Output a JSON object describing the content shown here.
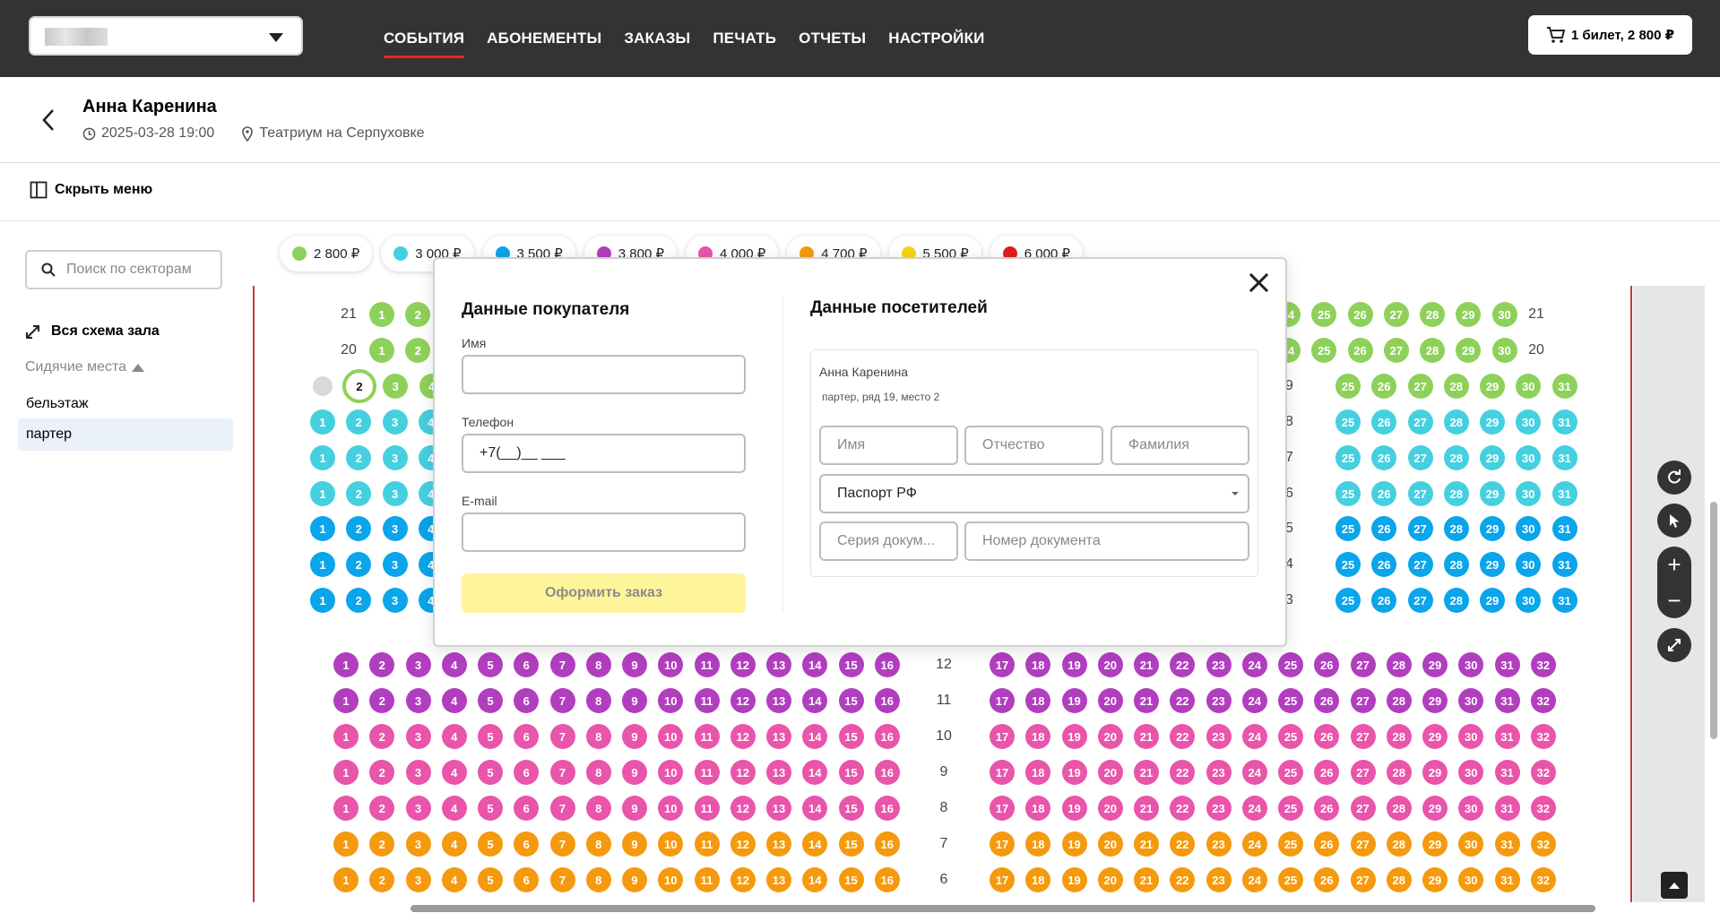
{
  "topbar": {
    "venue_select_value": "",
    "nav": [
      "СОБЫТИЯ",
      "АБОНЕМЕНТЫ",
      "ЗАКАЗЫ",
      "ПЕЧАТЬ",
      "ОТЧЕТЫ",
      "НАСТРОЙКИ"
    ],
    "active_nav": "СОБЫТИЯ",
    "cart_label": "1 билет, 2 800 ₽"
  },
  "event": {
    "title": "Анна Каренина",
    "datetime": "2025-03-28 19:00",
    "venue": "Театриум на Серпуховке"
  },
  "menu_toggle_label": "Скрыть меню",
  "sidebar": {
    "search_placeholder": "Поиск по секторам",
    "scheme_link": "Вся схема зала",
    "group_label": "Сидячие места",
    "sectors": [
      "бельэтаж",
      "партер"
    ],
    "active_sector": "партер"
  },
  "prices": [
    {
      "label": "2 800 ₽",
      "color": "#8ed15a"
    },
    {
      "label": "3 000 ₽",
      "color": "#45d0e0"
    },
    {
      "label": "3 500 ₽",
      "color": "#0aa5ea"
    },
    {
      "label": "3 800 ₽",
      "color": "#b13ebf"
    },
    {
      "label": "4 000 ₽",
      "color": "#e855aa"
    },
    {
      "label": "4 700 ₽",
      "color": "#f59a0e"
    },
    {
      "label": "5 500 ₽",
      "color": "#f8d512"
    },
    {
      "label": "6 000 ₽",
      "color": "#e21d1d"
    }
  ],
  "selected_seat": {
    "row": "19",
    "seat": "2"
  },
  "hall": {
    "top_rows": [
      {
        "row": "21",
        "color": "#8ed15a",
        "left": [
          1,
          2
        ],
        "right": [
          24,
          25,
          26,
          27,
          28,
          29,
          30
        ],
        "label_right": "21"
      },
      {
        "row": "20",
        "color": "#8ed15a",
        "left": [
          1,
          2
        ],
        "right": [
          24,
          25,
          26,
          27,
          28,
          29,
          30
        ],
        "label_right": "20"
      },
      {
        "row": "19",
        "color": "#8ed15a",
        "left": [
          2,
          3,
          4
        ],
        "right": [
          25,
          26,
          27,
          28,
          29,
          30,
          31
        ],
        "label_right": "19"
      },
      {
        "row": "18",
        "color": "#45d0e0",
        "left": [
          1,
          2,
          3,
          4
        ],
        "right": [
          25,
          26,
          27,
          28,
          29,
          30,
          31
        ],
        "label_right": "18"
      },
      {
        "row": "17",
        "color": "#45d0e0",
        "left": [
          1,
          2,
          3,
          4
        ],
        "right": [
          25,
          26,
          27,
          28,
          29,
          30,
          31
        ],
        "label_right": "17"
      },
      {
        "row": "16",
        "color": "#45d0e0",
        "left": [
          1,
          2,
          3,
          4
        ],
        "right": [
          25,
          26,
          27,
          28,
          29,
          30,
          31
        ],
        "label_right": "16"
      },
      {
        "row": "15",
        "color": "#0aa5ea",
        "left": [
          1,
          2,
          3,
          4
        ],
        "right": [
          25,
          26,
          27,
          28,
          29,
          30,
          31
        ],
        "label_right": "15"
      },
      {
        "row": "14",
        "color": "#0aa5ea",
        "left": [
          1,
          2,
          3,
          4
        ],
        "right": [
          25,
          26,
          27,
          28,
          29,
          30,
          31
        ],
        "label_right": "14"
      },
      {
        "row": "13",
        "color": "#0aa5ea",
        "left": [
          1,
          2,
          3,
          4
        ],
        "right": [
          25,
          26,
          27,
          28,
          29,
          30,
          31
        ],
        "label_right": "13"
      }
    ],
    "bottom_rows": [
      {
        "row": "12",
        "color": "#b13ebf"
      },
      {
        "row": "11",
        "color": "#b13ebf"
      },
      {
        "row": "10",
        "color": "#e855aa"
      },
      {
        "row": "9",
        "color": "#e855aa"
      },
      {
        "row": "8",
        "color": "#e855aa"
      },
      {
        "row": "7",
        "color": "#f59a0e"
      },
      {
        "row": "6",
        "color": "#f59a0e"
      }
    ]
  },
  "modal": {
    "buyer_title": "Данные покупателя",
    "name_label": "Имя",
    "name_value": "",
    "phone_label": "Телефон",
    "phone_value": "+7(__)__ ___",
    "email_label": "E-mail",
    "email_value": "",
    "submit_label": "Оформить заказ",
    "visitors_title": "Данные посетителей",
    "visitor": {
      "event_title": "Анна Каренина",
      "seat_info": "партер, ряд 19, место 2",
      "first_name_placeholder": "Имя",
      "patronymic_placeholder": "Отчество",
      "last_name_placeholder": "Фамилия",
      "doc_type": "Паспорт РФ",
      "doc_series_placeholder": "Серия докум...",
      "doc_number_placeholder": "Номер документа"
    }
  }
}
